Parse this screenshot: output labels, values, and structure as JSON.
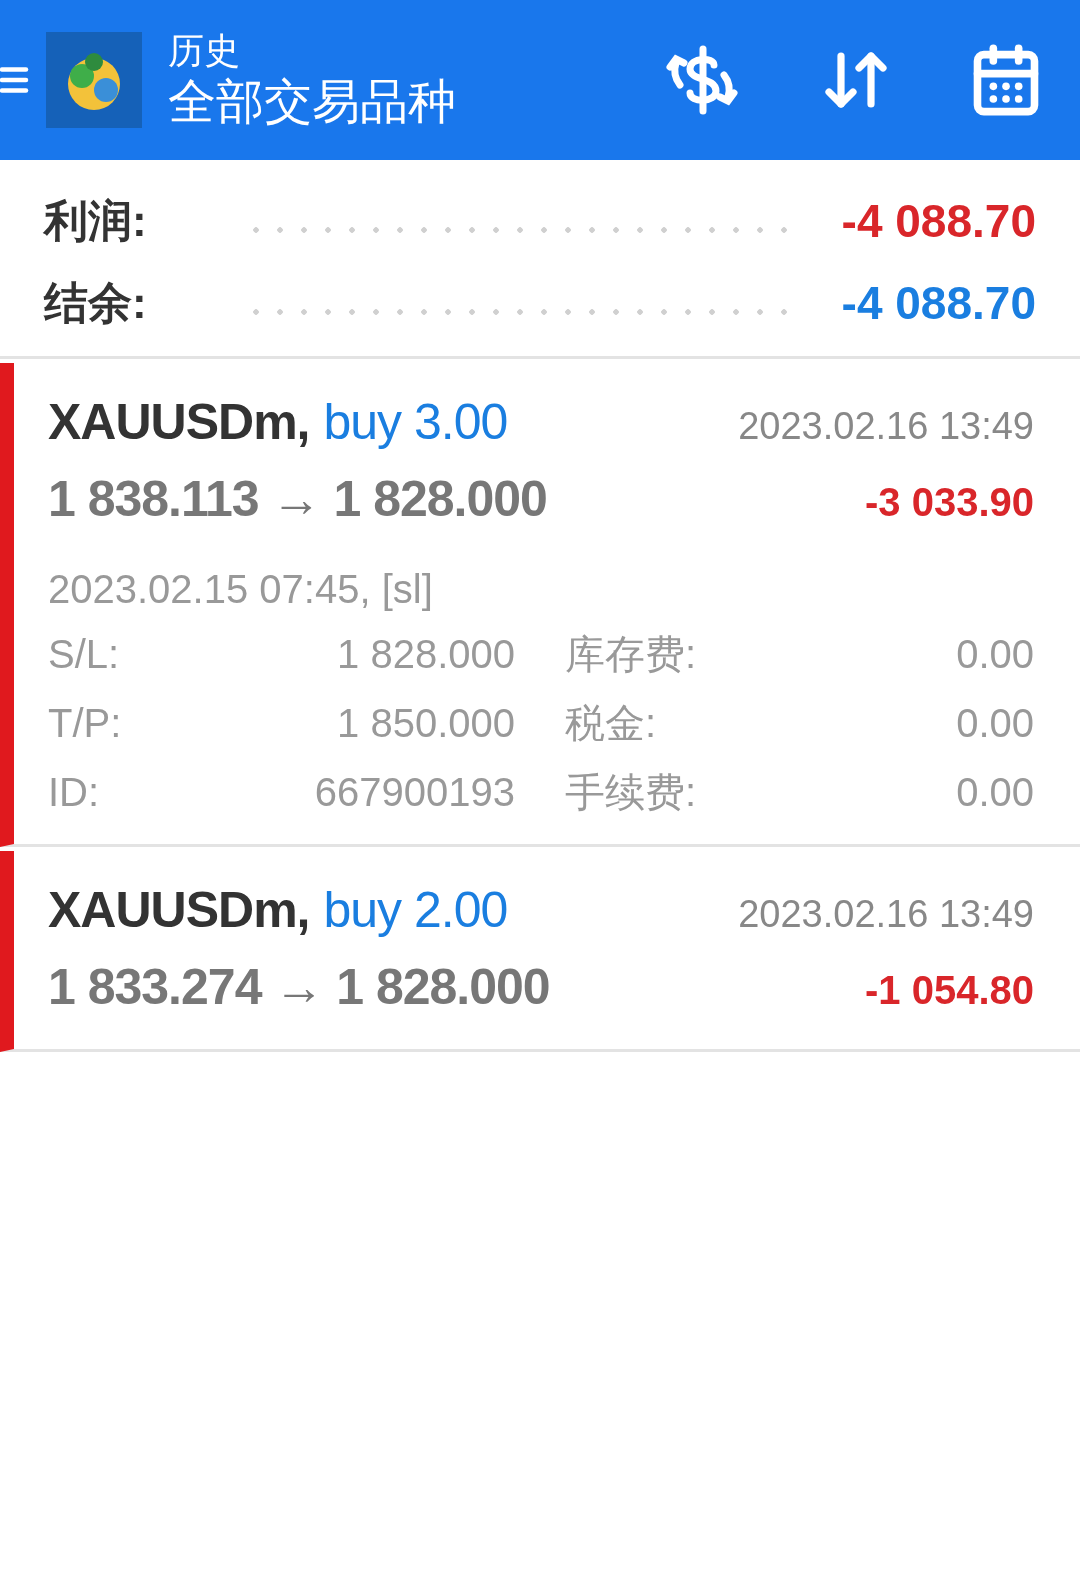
{
  "header": {
    "subtitle": "历史",
    "title": "全部交易品种"
  },
  "summary": [
    {
      "label": "利润:",
      "value": "-4 088.70",
      "color": "#d9262a"
    },
    {
      "label": "结余:",
      "value": "-4 088.70",
      "color": "#1a7ee0"
    }
  ],
  "deals": [
    {
      "symbol": "XAUUSDm,",
      "side": "buy 3.00",
      "time": "2023.02.16 13:49",
      "prices": "1 838.113 → 1 828.000",
      "profit": "-3 033.90",
      "expanded": true,
      "open_info": "2023.02.15 07:45, [sl]",
      "details": [
        {
          "label": "S/L:",
          "value": "1 828.000",
          "label_2": "库存费:",
          "value_2": "0.00"
        },
        {
          "label": "T/P:",
          "value": "1 850.000",
          "label_2": "税金:",
          "value_2": "0.00"
        },
        {
          "label": "ID:",
          "value": "667900193",
          "label_2": "手续费:",
          "value_2": "0.00"
        }
      ]
    },
    {
      "symbol": "XAUUSDm,",
      "side": "buy 2.00",
      "time": "2023.02.16 13:49",
      "prices": "1 833.274 → 1 828.000",
      "profit": "-1 054.80",
      "expanded": false
    }
  ]
}
